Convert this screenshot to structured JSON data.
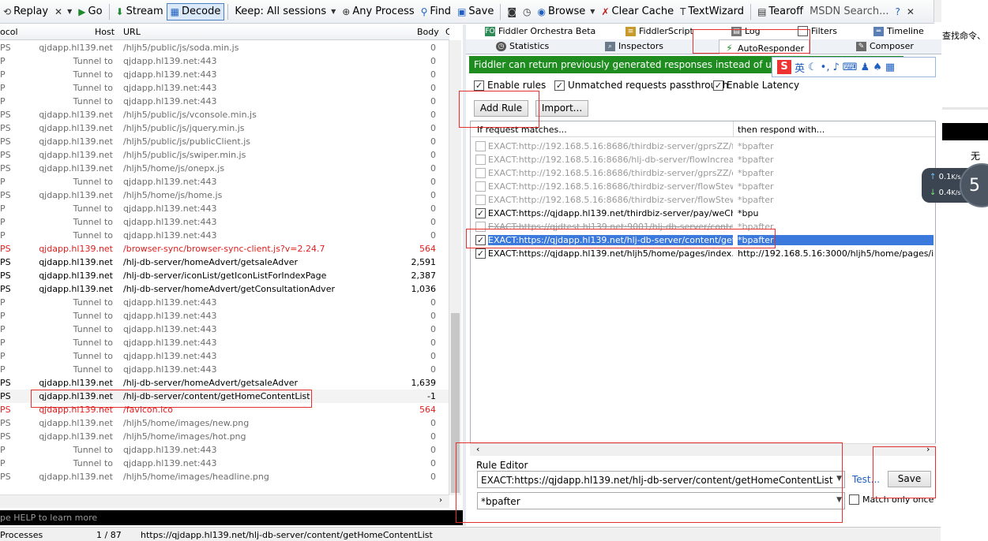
{
  "toolbar": {
    "replay": "Replay",
    "go": "Go",
    "stream": "Stream",
    "decode": "Decode",
    "keep": "Keep: All sessions",
    "any_process": "Any Process",
    "find": "Find",
    "save": "Save",
    "browse": "Browse",
    "clear_cache": "Clear Cache",
    "textwizard": "TextWizard",
    "tearoff": "Tearoff",
    "search": "MSDN Search..."
  },
  "sessions": {
    "columns": {
      "protocol": "ocol",
      "host": "Host",
      "url": "URL",
      "body": "Body",
      "extra": "C"
    },
    "rows": [
      {
        "pr": "PS",
        "host": "qjdapp.hl139.net",
        "url": "/hljh5/public/js/soda.min.js",
        "body": "0",
        "style": ""
      },
      {
        "pr": "P",
        "host": "Tunnel to",
        "url": "qjdapp.hl139.net:443",
        "body": "0",
        "style": ""
      },
      {
        "pr": "P",
        "host": "Tunnel to",
        "url": "qjdapp.hl139.net:443",
        "body": "0",
        "style": ""
      },
      {
        "pr": "P",
        "host": "Tunnel to",
        "url": "qjdapp.hl139.net:443",
        "body": "0",
        "style": ""
      },
      {
        "pr": "P",
        "host": "Tunnel to",
        "url": "qjdapp.hl139.net:443",
        "body": "0",
        "style": ""
      },
      {
        "pr": "PS",
        "host": "qjdapp.hl139.net",
        "url": "/hljh5/public/js/vconsole.min.js",
        "body": "0",
        "style": ""
      },
      {
        "pr": "PS",
        "host": "qjdapp.hl139.net",
        "url": "/hljh5/public/js/jquery.min.js",
        "body": "0",
        "style": ""
      },
      {
        "pr": "PS",
        "host": "qjdapp.hl139.net",
        "url": "/hljh5/public/js/publicClient.js",
        "body": "0",
        "style": ""
      },
      {
        "pr": "PS",
        "host": "qjdapp.hl139.net",
        "url": "/hljh5/public/js/swiper.min.js",
        "body": "0",
        "style": ""
      },
      {
        "pr": "PS",
        "host": "qjdapp.hl139.net",
        "url": "/hljh5/home/js/onepx.js",
        "body": "0",
        "style": ""
      },
      {
        "pr": "P",
        "host": "Tunnel to",
        "url": "qjdapp.hl139.net:443",
        "body": "0",
        "style": ""
      },
      {
        "pr": "PS",
        "host": "qjdapp.hl139.net",
        "url": "/hljh5/home/js/home.js",
        "body": "0",
        "style": ""
      },
      {
        "pr": "P",
        "host": "Tunnel to",
        "url": "qjdapp.hl139.net:443",
        "body": "0",
        "style": ""
      },
      {
        "pr": "P",
        "host": "Tunnel to",
        "url": "qjdapp.hl139.net:443",
        "body": "0",
        "style": ""
      },
      {
        "pr": "P",
        "host": "Tunnel to",
        "url": "qjdapp.hl139.net:443",
        "body": "0",
        "style": ""
      },
      {
        "pr": "PS",
        "host": "qjdapp.hl139.net",
        "url": "/browser-sync/browser-sync-client.js?v=2.24.7",
        "body": "564",
        "style": "red"
      },
      {
        "pr": "PS",
        "host": "qjdapp.hl139.net",
        "url": "/hlj-db-server/homeAdvert/getsaleAdver",
        "body": "2,591",
        "style": "dk"
      },
      {
        "pr": "PS",
        "host": "qjdapp.hl139.net",
        "url": "/hlj-db-server/iconList/getIconListForIndexPage",
        "body": "2,387",
        "style": "dk"
      },
      {
        "pr": "PS",
        "host": "qjdapp.hl139.net",
        "url": "/hlj-db-server/homeAdvert/getConsultationAdver",
        "body": "1,036",
        "style": "dk"
      },
      {
        "pr": "P",
        "host": "Tunnel to",
        "url": "qjdapp.hl139.net:443",
        "body": "0",
        "style": ""
      },
      {
        "pr": "P",
        "host": "Tunnel to",
        "url": "qjdapp.hl139.net:443",
        "body": "0",
        "style": ""
      },
      {
        "pr": "P",
        "host": "Tunnel to",
        "url": "qjdapp.hl139.net:443",
        "body": "0",
        "style": ""
      },
      {
        "pr": "P",
        "host": "Tunnel to",
        "url": "qjdapp.hl139.net:443",
        "body": "0",
        "style": ""
      },
      {
        "pr": "P",
        "host": "Tunnel to",
        "url": "qjdapp.hl139.net:443",
        "body": "0",
        "style": ""
      },
      {
        "pr": "P",
        "host": "Tunnel to",
        "url": "qjdapp.hl139.net:443",
        "body": "0",
        "style": ""
      },
      {
        "pr": "PS",
        "host": "qjdapp.hl139.net",
        "url": "/hlj-db-server/homeAdvert/getsaleAdver",
        "body": "1,639",
        "style": "dk"
      },
      {
        "pr": "PS",
        "host": "qjdapp.hl139.net",
        "url": "/hlj-db-server/content/getHomeContentList",
        "body": "-1",
        "style": "dk sel"
      },
      {
        "pr": "PS",
        "host": "qjdapp.hl139.net",
        "url": "/favicon.ico",
        "body": "564",
        "style": "red"
      },
      {
        "pr": "PS",
        "host": "qjdapp.hl139.net",
        "url": "/hljh5/home/images/new.png",
        "body": "0",
        "style": ""
      },
      {
        "pr": "PS",
        "host": "qjdapp.hl139.net",
        "url": "/hljh5/home/images/hot.png",
        "body": "0",
        "style": ""
      },
      {
        "pr": "P",
        "host": "Tunnel to",
        "url": "qjdapp.hl139.net:443",
        "body": "0",
        "style": ""
      },
      {
        "pr": "P",
        "host": "Tunnel to",
        "url": "qjdapp.hl139.net:443",
        "body": "0",
        "style": ""
      },
      {
        "pr": "PS",
        "host": "qjdapp.hl139.net",
        "url": "/hljh5/home/images/headline.png",
        "body": "0",
        "style": ""
      }
    ]
  },
  "quickexec": "pe HELP to learn more",
  "status": {
    "processes": "Processes",
    "count": "1 / 87",
    "url": "https://qjdapp.hl139.net/hlj-db-server/content/getHomeContentList"
  },
  "tabs": {
    "orchestra": "Fiddler Orchestra Beta",
    "script": "FiddlerScript",
    "log": "Log",
    "filters": "Filters",
    "timeline": "Timeline",
    "statistics": "Statistics",
    "inspectors": "Inspectors",
    "autoresponder": "AutoResponder",
    "composer": "Composer"
  },
  "banner": "Fiddler can return previously generated responses instead of using the netw",
  "ime": {
    "lang": "英"
  },
  "options": {
    "enable_rules": "Enable rules",
    "unmatched": "Unmatched requests passthrough",
    "latency": "Enable Latency"
  },
  "buttons": {
    "add_rule": "Add Rule",
    "import": "Import...",
    "test": "Test...",
    "save": "Save"
  },
  "rules": {
    "col_match": "If request matches...",
    "col_respond": "then respond with...",
    "items": [
      {
        "checked": false,
        "match": "EXACT:http://192.168.5.16:8686/thirdbiz-server/gprsZZ/firs...",
        "respond": "*bpafter",
        "style": "dim"
      },
      {
        "checked": false,
        "match": "EXACT:http://192.168.5.16:8686/hlj-db-server/flowIncrease...",
        "respond": "*bpafter",
        "style": "dim"
      },
      {
        "checked": false,
        "match": "EXACT:http://192.168.5.16:8686/thirdbiz-server/gprsZZ/qu...",
        "respond": "*bpafter",
        "style": "dim"
      },
      {
        "checked": false,
        "match": "EXACT:http://192.168.5.16:8686/thirdbiz-server/flowStewar...",
        "respond": "*bpafter",
        "style": "dim"
      },
      {
        "checked": false,
        "match": "EXACT:http://192.168.5.16:8686/thirdbiz-server/flowStewar...",
        "respond": "*bpafter",
        "style": "dim"
      },
      {
        "checked": true,
        "match": "EXACT:https://qjdapp.hl139.net/thirdbiz-server/pay/weChat...",
        "respond": "*bpu",
        "style": ""
      },
      {
        "checked": false,
        "match": "EXACT:https://qjdtest.hl139.net:9001/hlj-db-server/content...",
        "respond": "*bpafter",
        "style": "dim strike"
      },
      {
        "checked": true,
        "match": "EXACT:https://qjdapp.hl139.net/hlj-db-server/content/getH...",
        "respond": "*bpafter",
        "style": "sel"
      },
      {
        "checked": true,
        "match": "EXACT:https://qjdapp.hl139.net/hljh5/home/pages/index.ht...",
        "respond": "http://192.168.5.16:3000/hljh5/home/pages/i...",
        "style": ""
      }
    ]
  },
  "editor": {
    "label": "Rule Editor",
    "match_value": "EXACT:https://qjdapp.hl139.net/hlj-db-server/content/getHomeContentList",
    "respond_value": "*bpafter",
    "match_once": "Match only once"
  },
  "side": {
    "cmd": "查找命令、",
    "wu": "无"
  },
  "speed": {
    "up": "0.1",
    "down": "0.4",
    "unit": "K/s",
    "badge": "5"
  },
  "colors": {
    "banner": "#1e8c1e",
    "selection": "#3b79dc",
    "annotation": "#e53030",
    "red_text": "#e01e1e"
  }
}
